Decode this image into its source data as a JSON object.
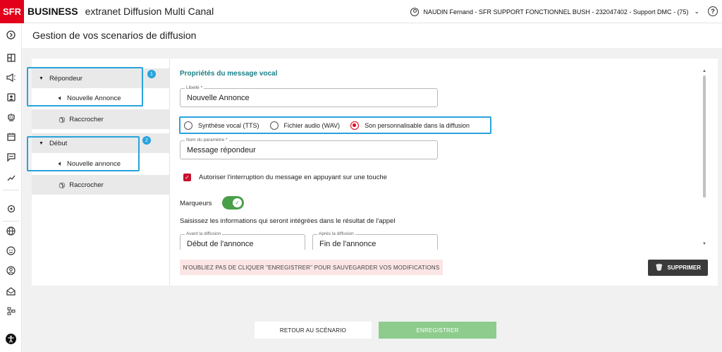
{
  "header": {
    "logo": "SFR",
    "brand": "BUSINESS",
    "app_title": "extranet Diffusion Multi Canal",
    "user": "NAUDIN Fernand - SFR SUPPORT FONCTIONNEL BUSH - 232047402 - Support DMC - (75)",
    "help": "?"
  },
  "rail_icons": [
    "chevron-right-icon",
    "dashboard-icon",
    "megaphone-icon",
    "contact-icon",
    "bot-icon",
    "calendar-icon",
    "message-icon",
    "trend-icon",
    "settings-icon",
    "globe-icon",
    "face-icon",
    "user-circle-icon",
    "inbox-icon",
    "hierarchy-icon",
    "accessibility-icon"
  ],
  "page": {
    "title": "Gestion de vos scenarios de diffusion"
  },
  "tree": [
    {
      "label": "Répondeur",
      "type": "group",
      "badge": "1"
    },
    {
      "label": "Nouvelle Annonce",
      "type": "announce"
    },
    {
      "label": "Raccrocher",
      "type": "hangup"
    },
    {
      "label": "Début",
      "type": "group",
      "badge": "2"
    },
    {
      "label": "Nouvelle annonce",
      "type": "announce"
    },
    {
      "label": "Raccrocher",
      "type": "hangup"
    }
  ],
  "form": {
    "title": "Propriétés du message vocal",
    "libelle_label": "Libellé *",
    "libelle_value": "Nouvelle Annonce",
    "radios": [
      {
        "label": "Synthèse vocal (TTS)",
        "selected": false
      },
      {
        "label": "Fichier audio (WAV)",
        "selected": false
      },
      {
        "label": "Son personnalisable dans la diffusion",
        "selected": true
      }
    ],
    "param_label": "Nom du paramètre *",
    "param_value": "Message répondeur",
    "checkbox_label": "Autoriser l'interruption du message en appuyant sur une touche",
    "checkbox_checked": true,
    "markers_label": "Marqueurs",
    "markers_on": true,
    "info_text": "Saisissez les informations qui seront intégrées dans le résultat de l'appel",
    "before_label": "Avant la diffusion",
    "before_value": "Début de l'annonce",
    "after_label": "Après la diffusion",
    "after_value": "Fin de l'annonce",
    "warning": "N'OUBLIEZ PAS DE CLIQUER \"ENREGISTRER\" POUR SAUVEGARDER VOS MODIFICATIONS",
    "delete_label": "SUPPRIMER"
  },
  "footer": {
    "back_label": "RETOUR AU SCÉNARIO",
    "save_label": "ENREGISTRER"
  },
  "colors": {
    "brand_red": "#e2001a",
    "accent_teal": "#1a7f87",
    "highlight_blue": "#29a3dc",
    "save_green": "#8dcc8d",
    "toggle_green": "#4a9f4a"
  }
}
